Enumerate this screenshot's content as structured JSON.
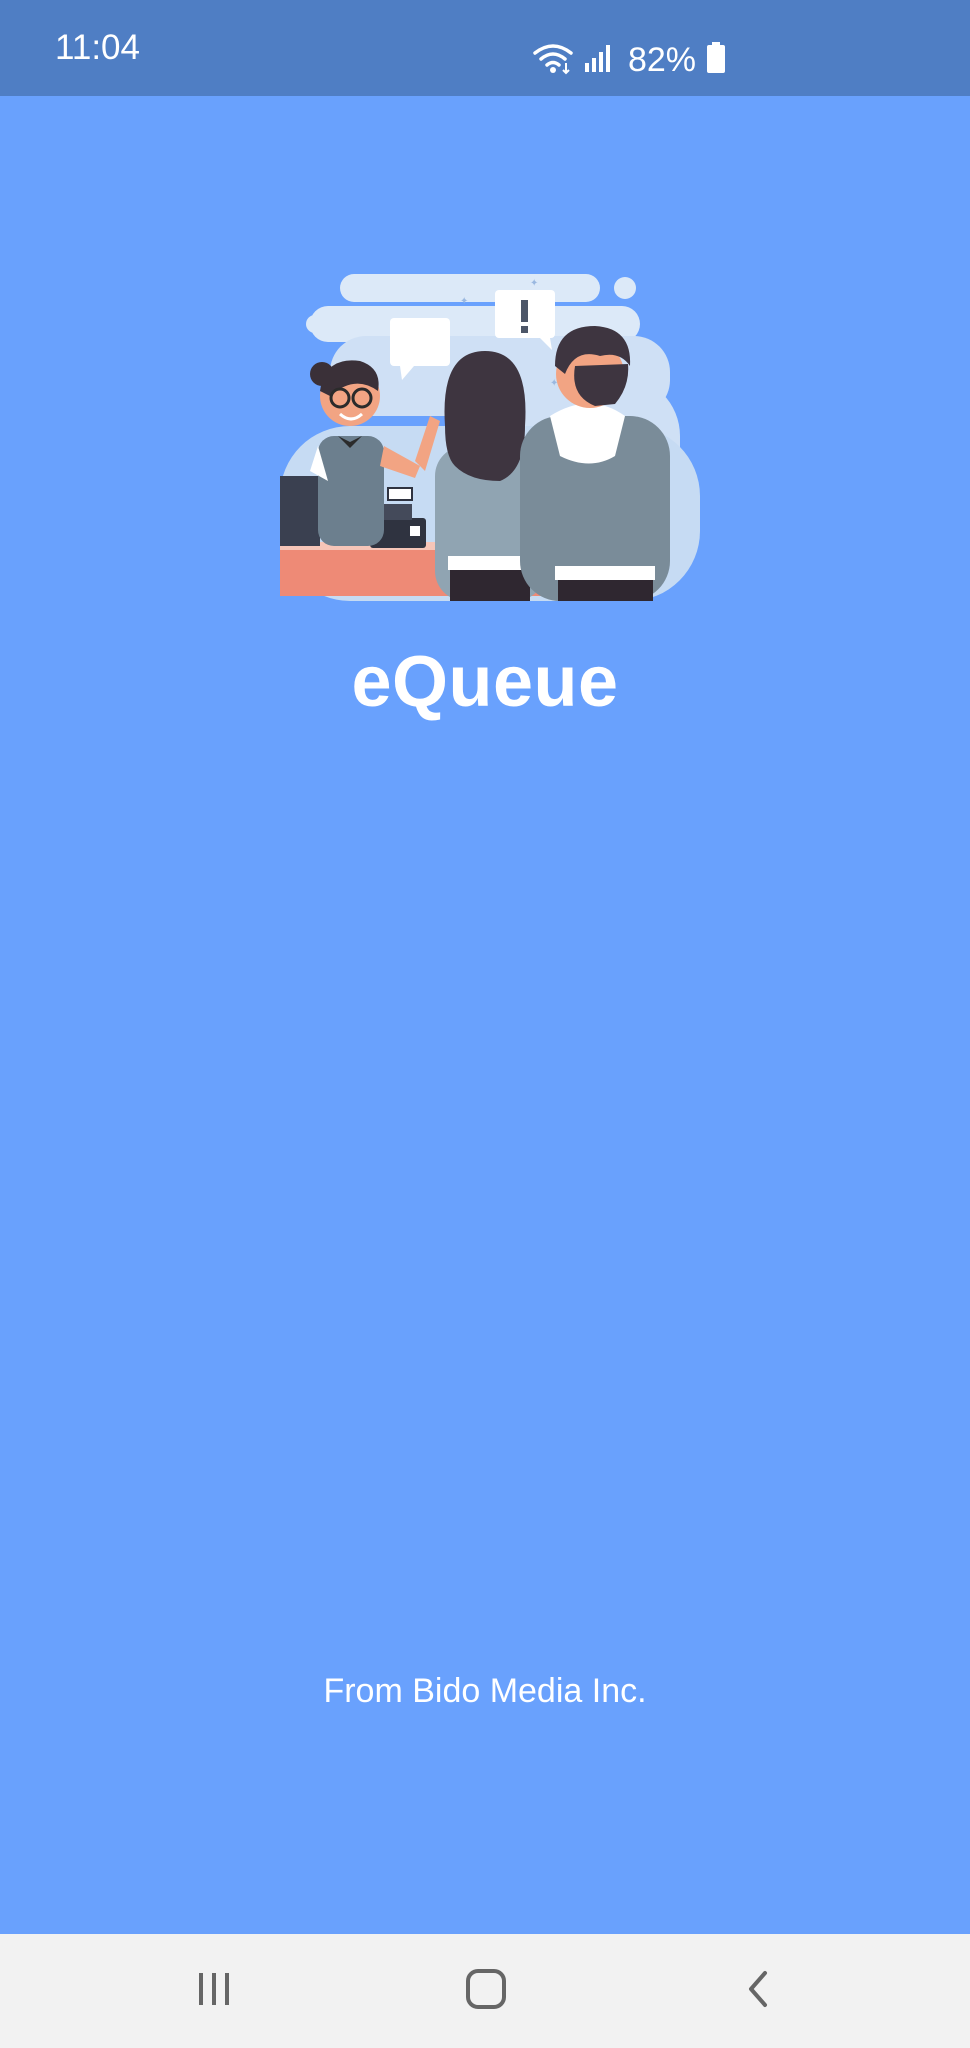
{
  "status_bar": {
    "time": "11:04",
    "battery_percent": "82%",
    "icons": [
      "wifi-icon",
      "signal-icon",
      "battery-icon"
    ]
  },
  "splash": {
    "app_name": "eQueue",
    "publisher_text": "From Bido Media Inc."
  },
  "nav_bar": {
    "buttons": [
      "recent-apps-icon",
      "home-icon",
      "back-icon"
    ]
  },
  "colors": {
    "background": "#69a1fd",
    "status_bar": "#4f7ec4",
    "nav_bar": "#f2f2f2",
    "text": "#ffffff"
  }
}
